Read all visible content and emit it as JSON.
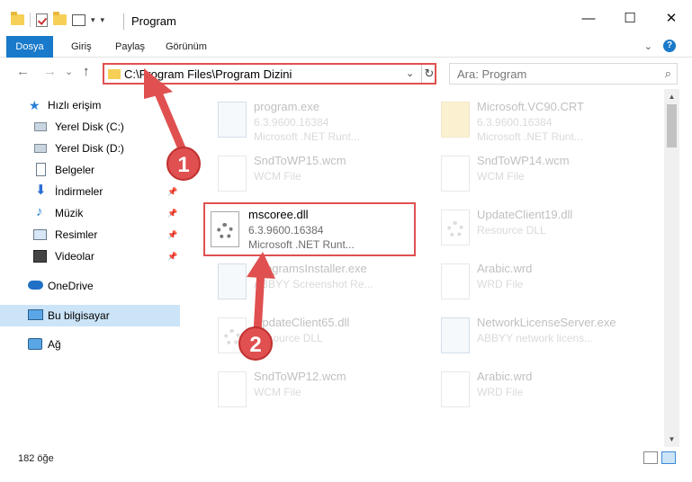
{
  "window": {
    "title": "Program",
    "controls": {
      "minimize": "—",
      "maximize": "☐",
      "close": "✕"
    }
  },
  "ribbon": {
    "tabs": [
      "Dosya",
      "Giriş",
      "Paylaş",
      "Görünüm"
    ],
    "help": "?"
  },
  "navigation": {
    "back": "←",
    "forward": "→",
    "recent": "⌄",
    "up": "↑",
    "address": "C:\\Program Files\\Program Dizini",
    "search_placeholder": "Ara: Program"
  },
  "sidebar": {
    "items": [
      {
        "label": "Hızlı erişim",
        "icon": "star-icon"
      },
      {
        "label": "Yerel Disk (C:)",
        "icon": "drive-icon"
      },
      {
        "label": "Yerel Disk (D:)",
        "icon": "drive-icon"
      },
      {
        "label": "Belgeler",
        "icon": "document-icon"
      },
      {
        "label": "İndirmeler",
        "icon": "download-icon"
      },
      {
        "label": "Müzik",
        "icon": "music-icon"
      },
      {
        "label": "Resimler",
        "icon": "pictures-icon"
      },
      {
        "label": "Videolar",
        "icon": "video-icon"
      },
      {
        "label": "OneDrive",
        "icon": "cloud-icon"
      },
      {
        "label": "Bu bilgisayar",
        "icon": "computer-icon"
      },
      {
        "label": "Ağ",
        "icon": "network-icon"
      }
    ]
  },
  "files": [
    {
      "name": "program.exe",
      "line1": "6.3.9600.16384",
      "line2": "Microsoft .NET Runt...",
      "icon": "exe-icon"
    },
    {
      "name": "Microsoft.VC90.CRT",
      "line1": "6.3.9600.16384",
      "line2": "Microsoft .NET Runt...",
      "icon": "folder-icon"
    },
    {
      "name": "SndToWP15.wcm",
      "line1": "WCM File",
      "line2": "",
      "icon": "file-icon"
    },
    {
      "name": "SndToWP14.wcm",
      "line1": "WCM File",
      "line2": "",
      "icon": "file-icon"
    },
    {
      "name": "mscoree.dll",
      "line1": "6.3.9600.16384",
      "line2": "Microsoft .NET Runt...",
      "icon": "dll-icon"
    },
    {
      "name": "UpdateClient19.dll",
      "line1": "Resource DLL",
      "line2": "",
      "icon": "dll-icon"
    },
    {
      "name": "ProgramsInstaller.exe",
      "line1": "ABBYY Screenshot Re...",
      "line2": "",
      "icon": "exe-icon"
    },
    {
      "name": "Arabic.wrd",
      "line1": "WRD File",
      "line2": "",
      "icon": "file-icon"
    },
    {
      "name": "UpdateClient65.dll",
      "line1": "Resource DLL",
      "line2": "",
      "icon": "dll-icon"
    },
    {
      "name": "NetworkLicenseServer.exe",
      "line1": "ABBYY network licens...",
      "line2": "",
      "icon": "exe-icon"
    },
    {
      "name": "SndToWP12.wcm",
      "line1": "WCM File",
      "line2": "",
      "icon": "file-icon"
    },
    {
      "name": "Arabic.wrd",
      "line1": "WRD File",
      "line2": "",
      "icon": "file-icon"
    }
  ],
  "status": {
    "count": "182 öğe"
  },
  "annotations": {
    "step1": "1",
    "step2": "2"
  },
  "colors": {
    "accent": "#1979ca",
    "highlight": "#e05050",
    "selected": "#cce4f7"
  }
}
